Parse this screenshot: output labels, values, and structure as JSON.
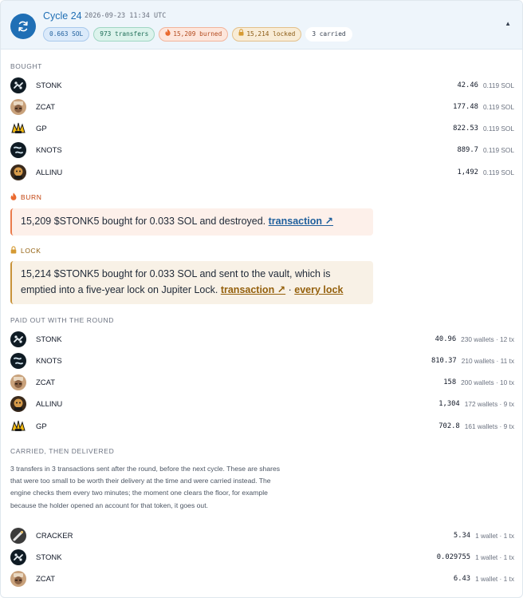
{
  "header": {
    "title": "Cycle 24",
    "date": "2026-09-23 11:34 UTC",
    "pills": {
      "sol": "0.663 SOL",
      "transfers": "973 transfers",
      "burned": "15,209 burned",
      "locked": "15,214 locked",
      "carried": "3 carried"
    },
    "collapse_icon": "caret-up-icon"
  },
  "bought": {
    "label": "BOUGHT",
    "rows": [
      {
        "token": "STONK",
        "amount": "42.46",
        "meta": "0.119 SOL"
      },
      {
        "token": "ZCAT",
        "amount": "177.48",
        "meta": "0.119 SOL"
      },
      {
        "token": "GP",
        "amount": "822.53",
        "meta": "0.119 SOL"
      },
      {
        "token": "KNOTS",
        "amount": "889.7",
        "meta": "0.119 SOL"
      },
      {
        "token": "ALLINU",
        "amount": "1,492",
        "meta": "0.119 SOL"
      }
    ]
  },
  "burn": {
    "label": "BURN",
    "icon": "flame-icon",
    "text": "15,209 $STONK5 bought for 0.033 SOL and destroyed. ",
    "link": "transaction ↗"
  },
  "lock": {
    "label": "LOCK",
    "icon": "lock-icon",
    "text": "15,214 $STONK5 bought for 0.033 SOL and sent to the vault, which is emptied into a five-year lock on Jupiter Lock. ",
    "link": "transaction ↗",
    "separator": " · ",
    "link2": "every lock"
  },
  "paid": {
    "label": "PAID OUT WITH THE ROUND",
    "rows": [
      {
        "token": "STONK",
        "amount": "40.96",
        "meta": "230 wallets · 12 tx"
      },
      {
        "token": "KNOTS",
        "amount": "810.37",
        "meta": "210 wallets · 11 tx"
      },
      {
        "token": "ZCAT",
        "amount": "158",
        "meta": "200 wallets · 10 tx"
      },
      {
        "token": "ALLINU",
        "amount": "1,304",
        "meta": "172 wallets · 9 tx"
      },
      {
        "token": "GP",
        "amount": "702.8",
        "meta": "161 wallets · 9 tx"
      }
    ]
  },
  "carried": {
    "label": "CARRIED, THEN DELIVERED",
    "note": "3 transfers in 3 transactions sent after the round, before the next cycle. These are shares that were too small to be worth their delivery at the time and were carried instead. The engine checks them every two minutes; the moment one clears the floor, for example because the holder opened an account for that token, it goes out.",
    "rows": [
      {
        "token": "CRACKER",
        "amount": "5.34",
        "meta": "1 wallet · 1 tx"
      },
      {
        "token": "STONK",
        "amount": "0.029755",
        "meta": "1 wallet · 1 tx"
      },
      {
        "token": "ZCAT",
        "amount": "6.43",
        "meta": "1 wallet · 1 tx"
      }
    ]
  },
  "colors": {
    "accent": "#1f6fb5",
    "burn": "#c2410c",
    "lock": "#92600f"
  }
}
